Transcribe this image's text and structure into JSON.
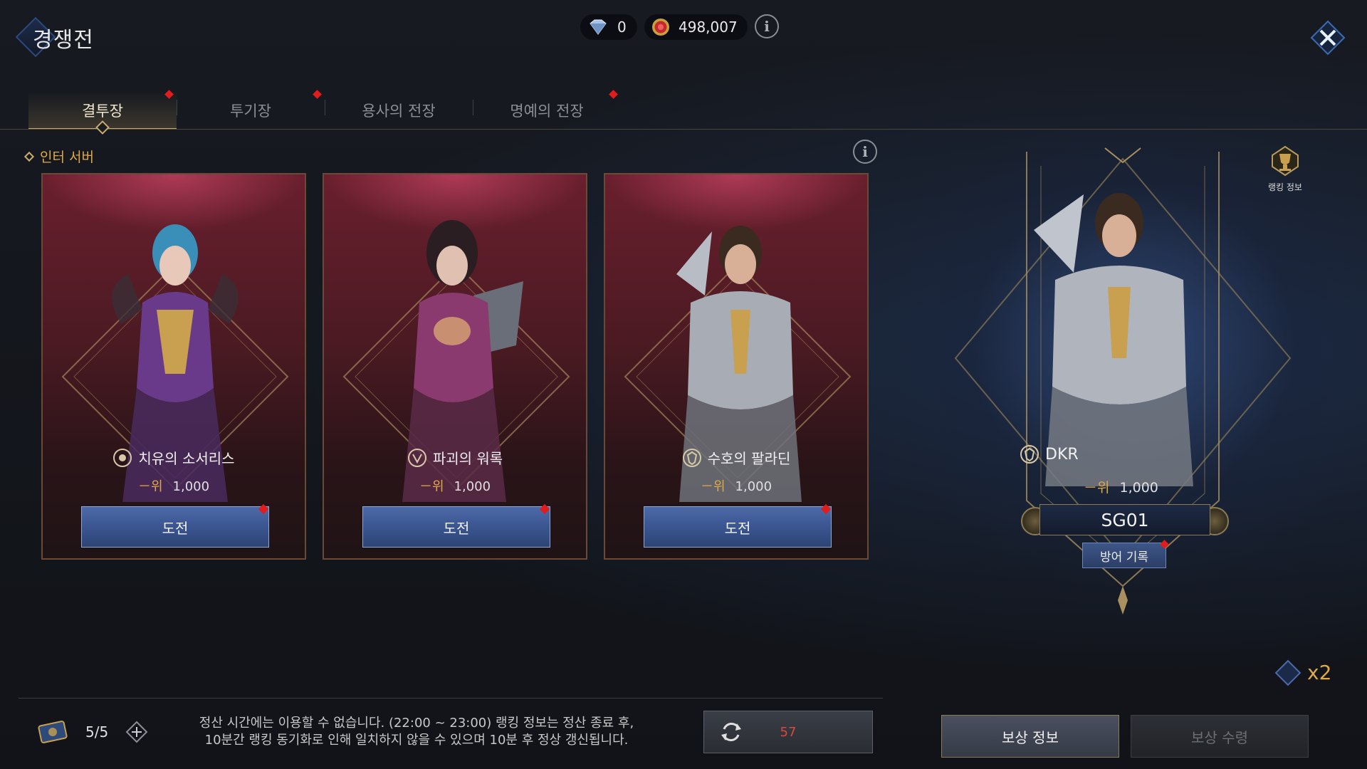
{
  "header": {
    "title": "경쟁전",
    "currencies": [
      {
        "icon": "diamond-gem-icon",
        "value": "0"
      },
      {
        "icon": "red-coin-icon",
        "value": "498,007"
      }
    ]
  },
  "tabs": [
    {
      "label": "결투장",
      "active": true,
      "badge": true
    },
    {
      "label": "투기장",
      "active": false,
      "badge": true
    },
    {
      "label": "용사의 전장",
      "active": false,
      "badge": false
    },
    {
      "label": "명예의 전장",
      "active": false,
      "badge": true
    }
  ],
  "section": {
    "label": "인터 서버"
  },
  "opponents": [
    {
      "class_name": "치유의 소서리스",
      "rank_label": "－위",
      "score": "1,000",
      "button": "도전",
      "portrait": "sorceress"
    },
    {
      "class_name": "파괴의 워록",
      "rank_label": "－위",
      "score": "1,000",
      "button": "도전",
      "portrait": "warlock"
    },
    {
      "class_name": "수호의 팔라딘",
      "rank_label": "－위",
      "score": "1,000",
      "button": "도전",
      "portrait": "paladin"
    }
  ],
  "me": {
    "name": "DKR",
    "rank_label": "－위",
    "score": "1,000",
    "server": "SG01",
    "defense_button": "방어 기록",
    "ranking_info_label": "랭킹 정보",
    "multiplier": "x2"
  },
  "bottom": {
    "tickets": "5/5",
    "notice_line1": "정산 시간에는 이용할 수 없습니다. (22:00 ~ 23:00) 랭킹 정보는 정산 종료 후,",
    "notice_line2": "10분간 랭킹 동기화로 인해 일치하지 않을 수 있으며 10분 후 정상 갱신됩니다.",
    "refresh_count": "57",
    "reward_info": "보상 정보",
    "reward_claim": "보상 수령"
  },
  "colors": {
    "accent_gold": "#e0a948",
    "badge_red": "#e01c1c",
    "button_blue": "#3a5590"
  }
}
